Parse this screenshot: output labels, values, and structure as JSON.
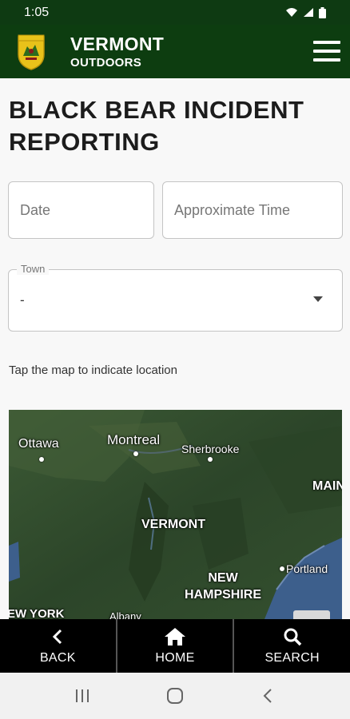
{
  "status_bar": {
    "time": "1:05"
  },
  "header": {
    "title": "VERMONT",
    "subtitle": "OUTDOORS"
  },
  "page_title": "BLACK BEAR INCIDENT REPORTING",
  "form": {
    "date_placeholder": "Date",
    "time_placeholder": "Approximate Time",
    "town_label": "Town",
    "town_value": "-"
  },
  "map_hint": "Tap the map to indicate location",
  "map": {
    "labels": {
      "ottawa": "Ottawa",
      "montreal": "Montreal",
      "sherbrooke": "Sherbrooke",
      "maine": "MAIN",
      "vermont": "VERMONT",
      "portland": "Portland",
      "new_hampshire_1": "NEW",
      "new_hampshire_2": "HAMPSHIRE",
      "new_york": "EW YORK",
      "albany": "Albany"
    }
  },
  "bottom_nav": [
    {
      "label": "BACK",
      "icon": "chevron-left-icon"
    },
    {
      "label": "HOME",
      "icon": "home-icon"
    },
    {
      "label": "SEARCH",
      "icon": "search-icon"
    }
  ],
  "colors": {
    "header_bg": "#0d3d10",
    "status_bg": "#0e3a12",
    "nav_bg": "#000000",
    "logo_gold": "#e8c21a"
  }
}
